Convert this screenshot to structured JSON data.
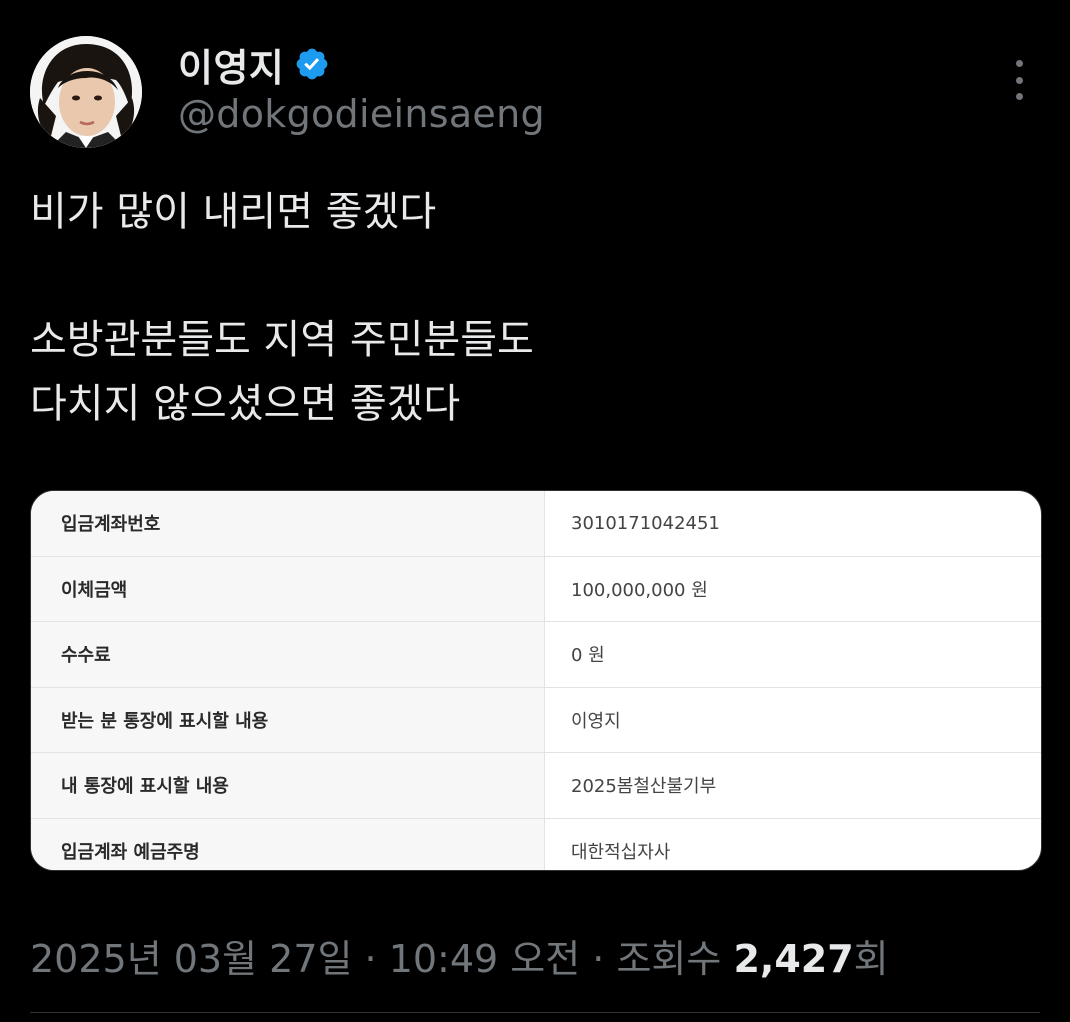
{
  "author": {
    "display_name": "이영지",
    "handle": "@dokgodieinsaeng",
    "verified_color": "#1d9bf0"
  },
  "tweet": {
    "lines": [
      "비가 많이 내리면 좋겠다",
      "",
      "소방관분들도 지역 주민분들도",
      "다치지 않으셨으면 좋겠다"
    ]
  },
  "receipt": {
    "rows": [
      {
        "label": "입금계좌번호",
        "value": "3010171042451"
      },
      {
        "label": "이체금액",
        "value": "100,000,000 원"
      },
      {
        "label": "수수료",
        "value": "0 원"
      },
      {
        "label": "받는 분 통장에 표시할 내용",
        "value": "이영지"
      },
      {
        "label": "내 통장에 표시할 내용",
        "value": "2025봄철산불기부"
      },
      {
        "label": "입금계좌 예금주명",
        "value": "대한적십자사"
      }
    ]
  },
  "meta": {
    "date": "2025년 03월 27일",
    "separator1": " · ",
    "time": "10:49 오전",
    "separator2": " · ",
    "views_label": "조회수 ",
    "views_count": "2,427",
    "views_suffix": "회"
  }
}
